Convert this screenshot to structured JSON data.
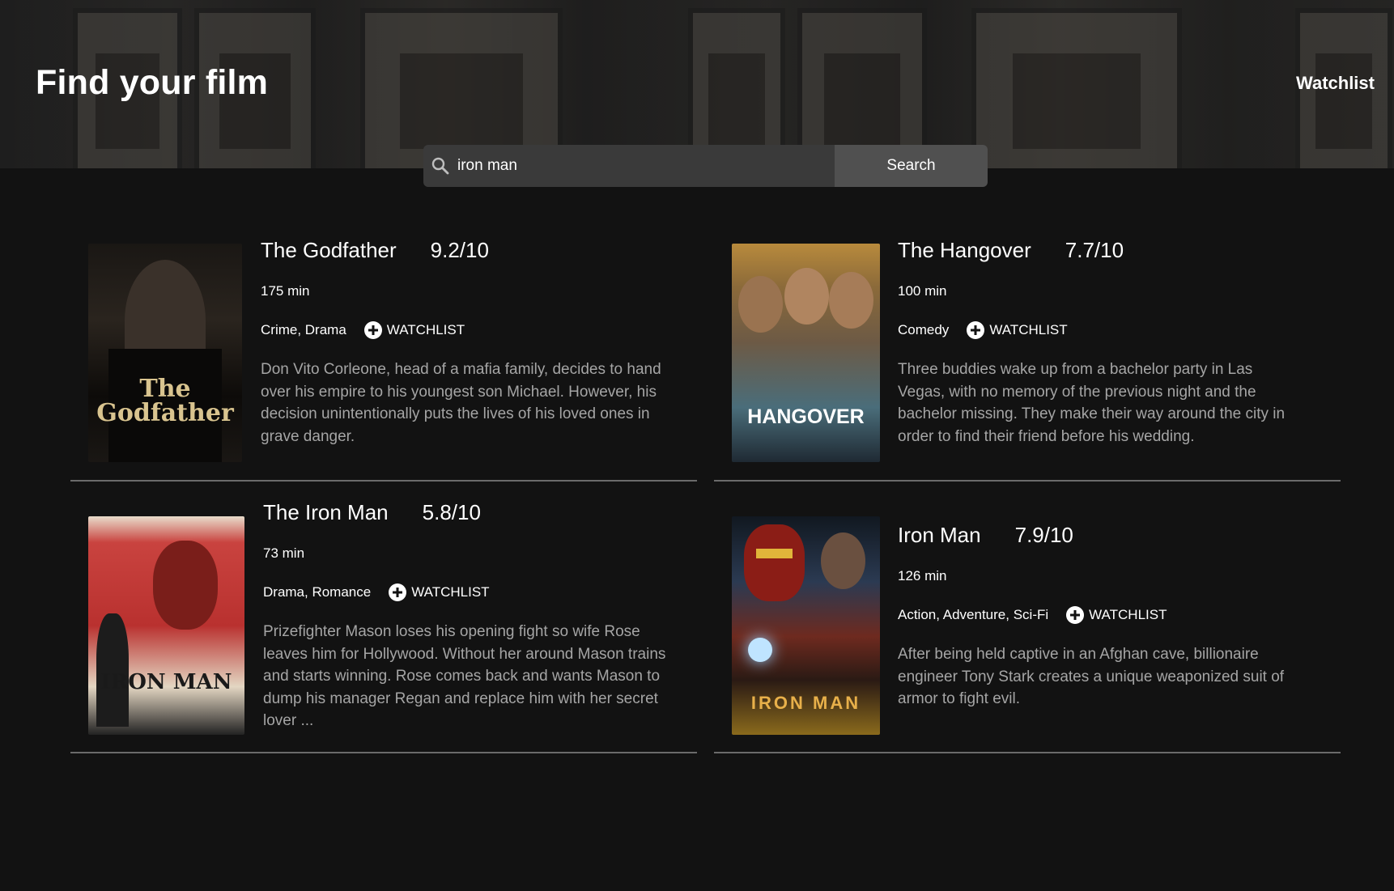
{
  "header": {
    "title": "Find your film",
    "nav_watchlist": "Watchlist"
  },
  "search": {
    "value": "iron man",
    "button_label": "Search"
  },
  "results": [
    {
      "title": "The Godfather",
      "rating": "9.2/10",
      "runtime": "175 min",
      "genres": "Crime, Drama",
      "watchlist_label": "WATCHLIST",
      "description": "Don Vito Corleone, head of a mafia family, decides to hand over his empire to his youngest son Michael. However, his decision unintentionally puts the lives of his loved ones in grave danger.",
      "poster_text": "The Godfather"
    },
    {
      "title": "The Hangover",
      "rating": "7.7/10",
      "runtime": "100 min",
      "genres": "Comedy",
      "watchlist_label": "WATCHLIST",
      "description": "Three buddies wake up from a bachelor party in Las Vegas, with no memory of the previous night and the bachelor missing. They make their way around the city in order to find their friend before his wedding.",
      "poster_text": "HANGOVER"
    },
    {
      "title": "The Iron Man",
      "rating": "5.8/10",
      "runtime": "73 min",
      "genres": "Drama, Romance",
      "watchlist_label": "WATCHLIST",
      "description": "Prizefighter Mason loses his opening fight so wife Rose leaves him for Hollywood. Without her around Mason trains and starts winning. Rose comes back and wants Mason to dump his manager Regan and replace him with her secret lover ...",
      "poster_text": "IRON MAN"
    },
    {
      "title": "Iron Man",
      "rating": "7.9/10",
      "runtime": "126 min",
      "genres": "Action, Adventure, Sci-Fi",
      "watchlist_label": "WATCHLIST",
      "description": "After being held captive in an Afghan cave, billionaire engineer Tony Stark creates a unique weaponized suit of armor to fight evil.",
      "poster_text": "IRON MAN"
    }
  ]
}
